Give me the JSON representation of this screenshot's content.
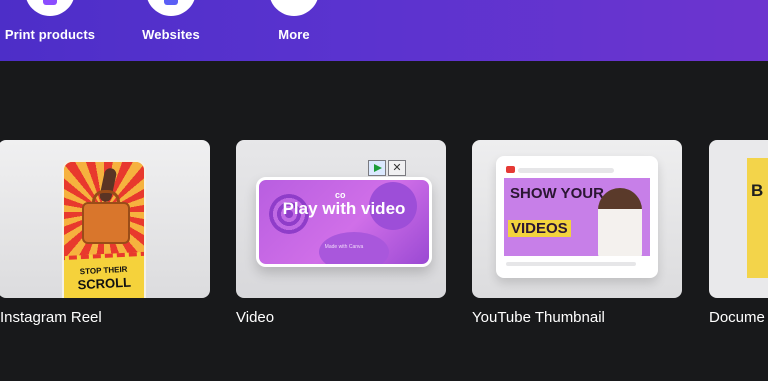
{
  "categories": [
    {
      "label": "Print products",
      "icon": "print-products-icon",
      "accent": "#8b4dff"
    },
    {
      "label": "Websites",
      "icon": "websites-icon",
      "accent": "#5b5ff5"
    },
    {
      "label": "More",
      "icon": "more-icon",
      "accent": "#ffffff"
    }
  ],
  "templates": [
    {
      "label": "Instagram Reel",
      "thumb_text_1": "STOP THEIR",
      "thumb_text_2": "SCROLL"
    },
    {
      "label": "Video",
      "thumb_title": "Play with video",
      "thumb_logo": "co",
      "thumb_sub": "Made with Canva"
    },
    {
      "label": "YouTube Thumbnail",
      "thumb_text_1": "SHOW YOUR",
      "thumb_text_2": "VIDEOS"
    },
    {
      "label": "Docume",
      "thumb_text": "B R"
    }
  ],
  "colors": {
    "band_start": "#4d2ec8",
    "band_end": "#6d34cf",
    "background": "#18191b",
    "card": "#e8e8ea"
  }
}
